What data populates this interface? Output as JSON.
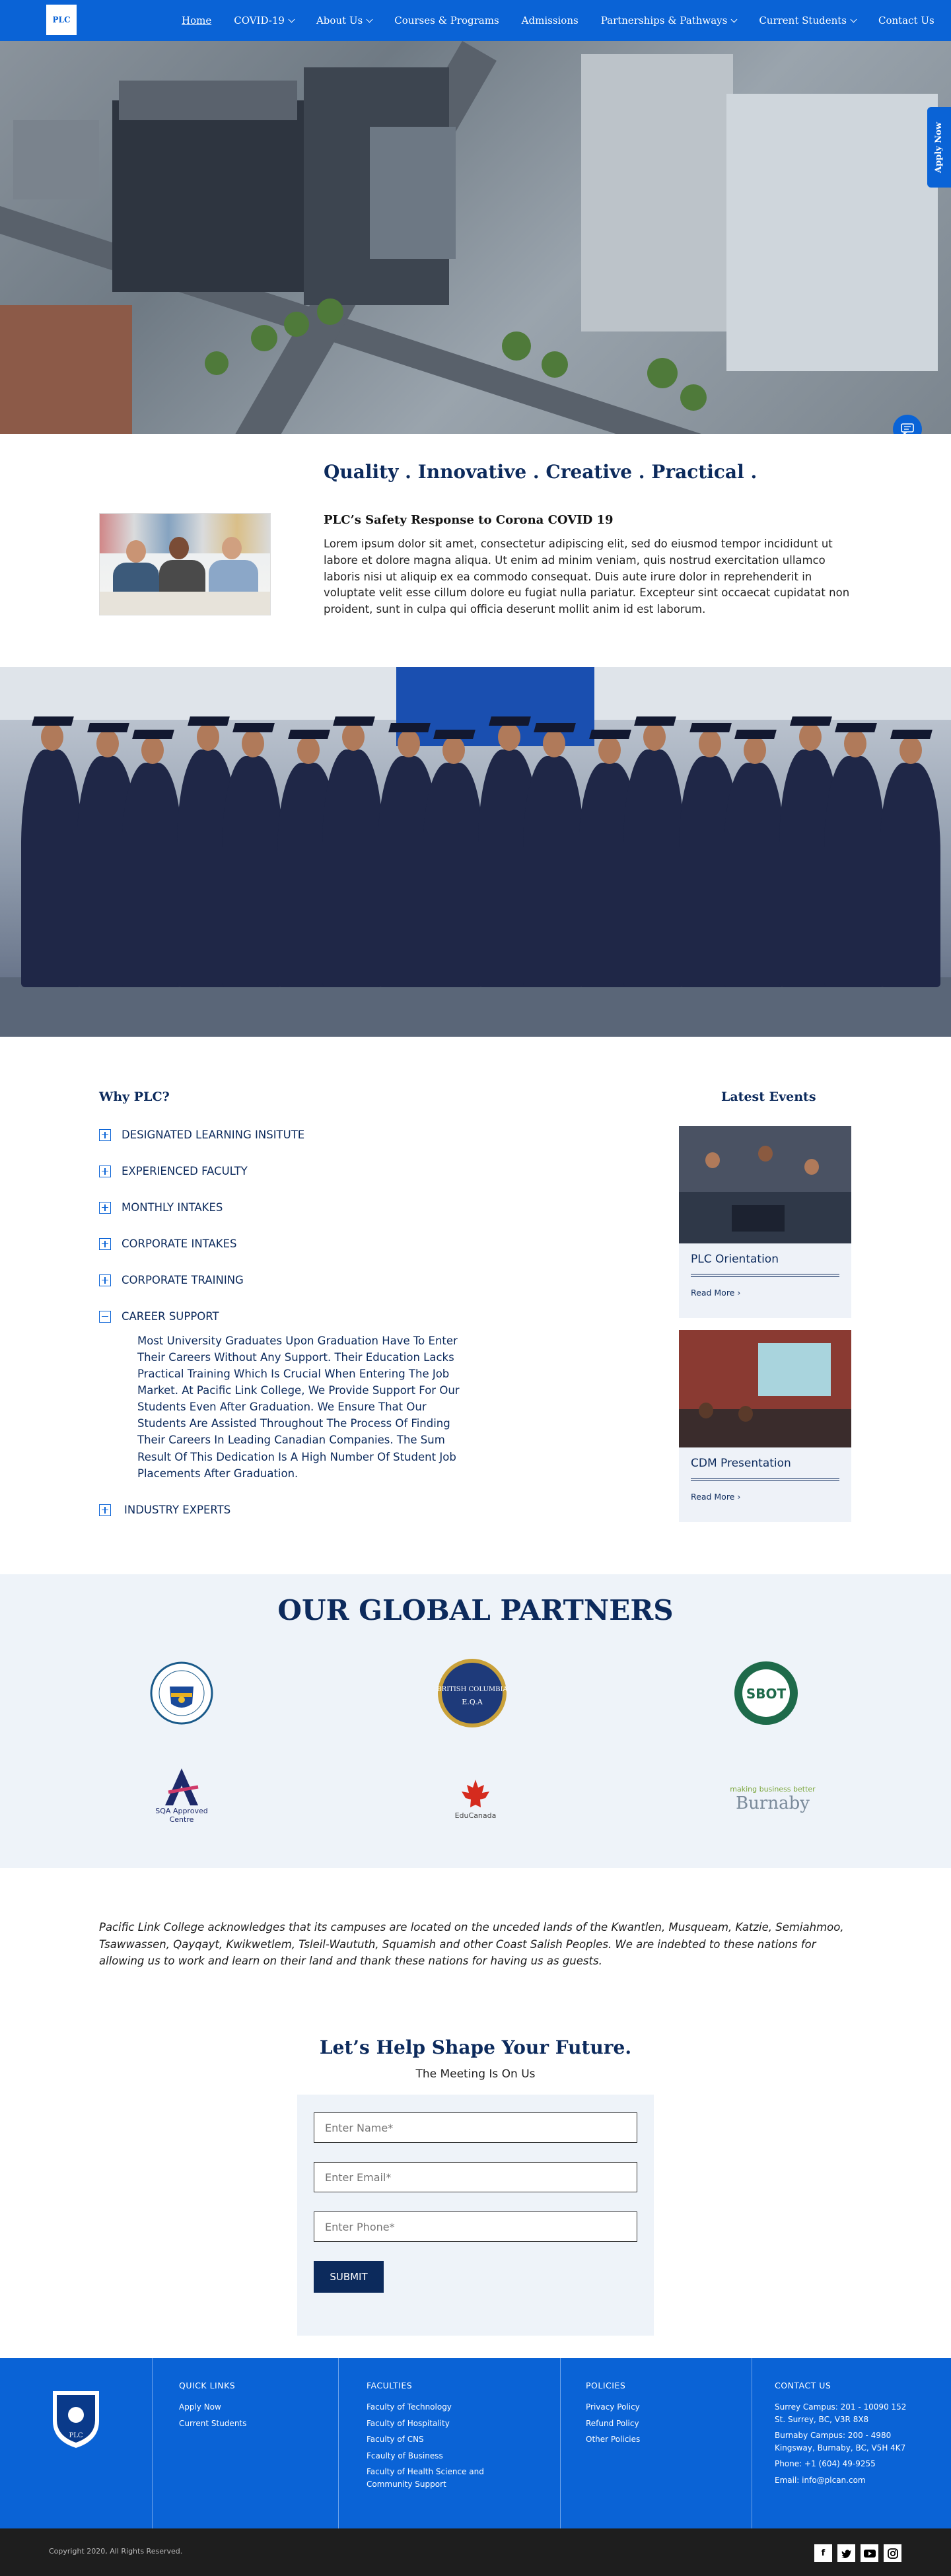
{
  "nav": {
    "logo": "PLC",
    "items": [
      {
        "label": "Home",
        "active": true,
        "dropdown": false
      },
      {
        "label": "COVID-19",
        "dropdown": true
      },
      {
        "label": "About Us",
        "dropdown": true
      },
      {
        "label": "Courses & Programs",
        "dropdown": false
      },
      {
        "label": "Admissions",
        "dropdown": false
      },
      {
        "label": "Partnerships & Pathways",
        "dropdown": true
      },
      {
        "label": "Current Students",
        "dropdown": true
      },
      {
        "label": "Contact Us",
        "dropdown": false
      }
    ]
  },
  "apply_now": "Apply Now",
  "intro": {
    "tagline": "Quality . Innovative . Creative . Practical .",
    "heading": "PLC’s Safety Response to Corona COVID 19",
    "body": "Lorem ipsum dolor sit amet, consectetur adipiscing elit, sed do eiusmod tempor incididunt ut labore et dolore magna aliqua. Ut enim ad minim veniam, quis nostrud exercitation ullamco laboris nisi ut aliquip ex ea commodo consequat. Duis aute irure dolor in reprehenderit in voluptate velit esse cillum dolore eu fugiat nulla pariatur. Excepteur sint occaecat cupidatat non proident, sunt in culpa qui officia deserunt mollit anim id est laborum."
  },
  "why": {
    "title": "Why PLC?",
    "items": [
      "DESIGNATED LEARNING INSITUTE",
      "EXPERIENCED FACULTY",
      "MONTHLY INTAKES",
      "CORPORATE INTAKES",
      "CORPORATE TRAINING",
      "CAREER SUPPORT",
      "INDUSTRY EXPERTS"
    ],
    "expanded_body": "Most University Graduates Upon Graduation Have To Enter Their Careers Without Any Support. Their Education Lacks Practical Training Which Is Crucial When Entering The Job Market. At Pacific Link College, We Provide Support For Our Students Even After Graduation. We Ensure That Our Students Are Assisted Throughout The Process Of Finding Their Careers In Leading Canadian Companies. The Sum Result Of This Dedication Is A High Number Of Student Job Placements After Graduation."
  },
  "events": {
    "title": "Latest Events",
    "items": [
      {
        "title": "PLC Orientation",
        "link": "Read More"
      },
      {
        "title": "CDM Presentation",
        "link": "Read More"
      }
    ]
  },
  "partners": {
    "title": "OUR GLOBAL PARTNERS",
    "logos": [
      "designated-logo",
      "british-columbia-eqa-logo",
      "sbot-logo",
      "sqa-approved-centre-logo",
      "educanada-logo",
      "burnaby-board-of-trade-logo"
    ],
    "sqa_text": "SQA Approved Centre",
    "eqa_text": "BRITISH COLUMBIA",
    "eqa_sub": "E.Q.A",
    "sbot_text": "SBOT",
    "educanada_text": "EduCanada",
    "burnaby_tag": "making business better",
    "burnaby_name": "Burnaby"
  },
  "acknowledgement": "Pacific Link College acknowledges that its campuses are located on the unceded lands of the Kwantlen, Musqueam, Katzie, Semiahmoo, Tsawwassen, Qayqayt, Kwikwetlem, Tsleil-Waututh, Squamish and other Coast Salish Peoples. We are indebted to these nations for allowing us to work and learn on their land and thank these nations for having us as guests.",
  "form": {
    "title": "Let’s Help Shape Your Future.",
    "subtitle": "The Meeting Is On Us",
    "name_placeholder": "Enter Name*",
    "email_placeholder": "Enter Email*",
    "phone_placeholder": "Enter Phone*",
    "submit": "SUBMIT"
  },
  "footer": {
    "quick_links": {
      "title": "QUICK LINKS",
      "items": [
        "Apply Now",
        "Current Students"
      ]
    },
    "faculties": {
      "title": "FACULTIES",
      "items": [
        "Faculty of Technology",
        "Faculty of  Hospitality",
        "Faculty of CNS",
        "Fcaulty of Business",
        "Faculty of Health Science and Community Support"
      ]
    },
    "policies": {
      "title": "POLICIES",
      "items": [
        "Privacy Policy",
        "Refund Policy",
        "Other Policies"
      ]
    },
    "contact": {
      "title": "CONTACT US",
      "items": [
        "Surrey Campus: 201 - 10090 152 St. Surrey, BC, V3R 8X8",
        "Burnaby Campus: 200 - 4980 Kingsway, Burnaby, BC, V5H 4K7",
        "Phone: +1 (604) 49-9255",
        "Email: info@plcan.com"
      ]
    },
    "logo_text": "PLC"
  },
  "copyright": "Copyright 2020, All Rights Reserved.",
  "social": [
    "facebook-icon",
    "twitter-icon",
    "youtube-icon",
    "instagram-icon"
  ],
  "colors": {
    "primary": "#0a63d6",
    "navy": "#0c2a5c",
    "light_bg": "#eef3f9",
    "dark": "#1e1e1e"
  }
}
